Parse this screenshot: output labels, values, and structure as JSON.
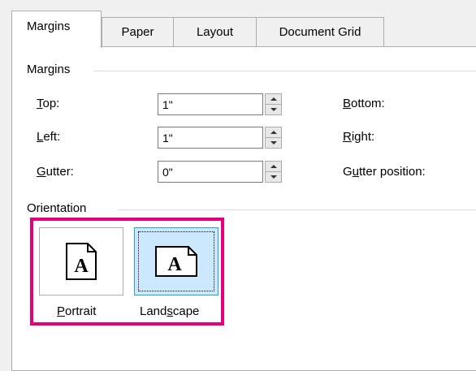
{
  "tabs": [
    {
      "label": "Margins",
      "active": true
    },
    {
      "label": "Paper",
      "active": false
    },
    {
      "label": "Layout",
      "active": false
    },
    {
      "label": "Document Grid",
      "active": false
    }
  ],
  "margins_group": {
    "title": "Margins",
    "top": {
      "label_key": "T",
      "label_rest": "op:",
      "value": "1\""
    },
    "left": {
      "label_key": "L",
      "label_rest": "eft:",
      "value": "1\""
    },
    "gutter": {
      "label_key": "G",
      "label_rest": "utter:",
      "value": "0\""
    },
    "bottom": {
      "label_key": "B",
      "label_rest": "ottom:"
    },
    "right": {
      "label_key": "R",
      "label_rest": "ight:"
    },
    "gutter_position": {
      "label_pre": "G",
      "label_key": "u",
      "label_rest": "tter position:"
    }
  },
  "orientation_group": {
    "title": "Orientation",
    "portrait": {
      "label_key": "P",
      "label_rest": "ortrait",
      "icon_letter": "A"
    },
    "landscape": {
      "label_pre": "Land",
      "label_key": "s",
      "label_rest": "cape",
      "icon_letter": "A",
      "selected": true
    }
  },
  "colors": {
    "highlight": "#e4007c",
    "selection": "#cce8ff",
    "selection_border": "#26a0da"
  }
}
